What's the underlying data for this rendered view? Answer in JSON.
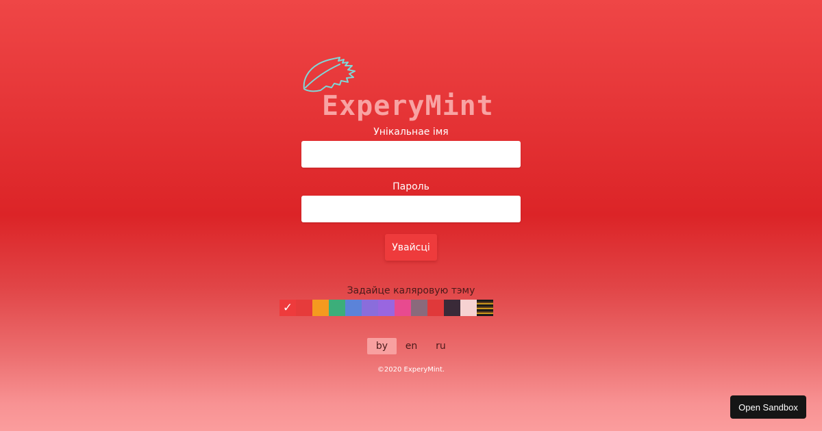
{
  "brand": {
    "name": "ExperyMint",
    "logo_icon": "mint-leaf-icon",
    "logo_color": "#f8a3a3",
    "leaf_color": "#7fd8d8"
  },
  "form": {
    "username_label": "Унікальнае імя",
    "username_value": "",
    "password_label": "Пароль",
    "password_value": "",
    "submit_label": "Увайсці"
  },
  "theme": {
    "title": "Задайце каляровую тэму",
    "selected_mark": "✓",
    "swatches": [
      {
        "color": "#ee3b3c",
        "selected": true
      },
      {
        "color": "#e63b3b",
        "selected": false
      },
      {
        "color": "#f59a1f",
        "selected": false
      },
      {
        "color": "#3cae7a",
        "selected": false
      },
      {
        "color": "#5b83d9",
        "selected": false
      },
      {
        "color": "#8a6ddc",
        "selected": false
      },
      {
        "color": "#9966e0",
        "selected": false
      },
      {
        "color": "#e84a8f",
        "selected": false
      },
      {
        "color": "#8a6a7c",
        "selected": false
      },
      {
        "color": "#e0393a",
        "selected": false
      },
      {
        "color": "#3a2a38",
        "selected": false
      },
      {
        "color": "#f6d2d2",
        "selected": false
      },
      {
        "color": "pattern",
        "selected": false
      }
    ]
  },
  "languages": {
    "items": [
      "by",
      "en",
      "ru"
    ],
    "active": "by"
  },
  "footer": {
    "copyright": "©2020 ExperyMint."
  },
  "sandbox_button": "Open Sandbox"
}
